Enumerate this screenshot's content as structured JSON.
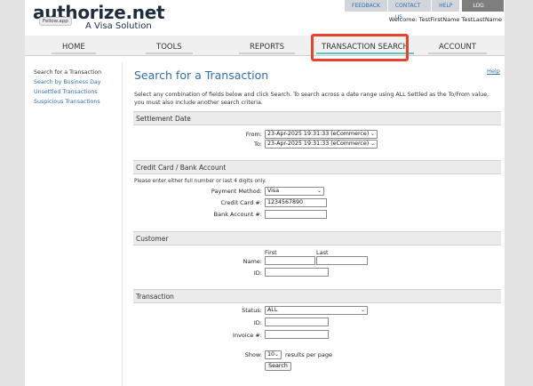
{
  "header": {
    "logo": "authorize.net",
    "tagline": "A Visa Solution",
    "badge": "Fellow.app",
    "welcome": "Welcome: TestFirstName TestLastName",
    "links": [
      "FEEDBACK",
      "CONTACT US",
      "HELP"
    ],
    "logout": "LOG OUT"
  },
  "nav": {
    "tabs": [
      "HOME",
      "TOOLS",
      "REPORTS",
      "TRANSACTION SEARCH",
      "ACCOUNT"
    ],
    "active": "TRANSACTION SEARCH"
  },
  "sidebar": {
    "items": [
      "Search for a Transaction",
      "Search by Business Day",
      "Unsettled Transactions",
      "Suspicious Transactions"
    ]
  },
  "main": {
    "title": "Search for a Transaction",
    "help": "Help",
    "intro": "Select any combination of fields below and click Search. To search across a date range using ALL Settled as the To/From value, you must also include another search criteria."
  },
  "settlement": {
    "heading": "Settlement Date",
    "from_label": "From:",
    "from_value": "23-Apr-2025 19:31:33 (eCommerce)",
    "to_label": "To:",
    "to_value": "23-Apr-2025 19:31:33 (eCommerce)"
  },
  "card": {
    "heading": "Credit Card / Bank Account",
    "note": "Please enter either full number or last 4 digits only.",
    "payment_label": "Payment Method:",
    "payment_value": "Visa",
    "cc_label": "Credit Card #:",
    "cc_value": "1234567890",
    "bank_label": "Bank Account #:",
    "bank_value": ""
  },
  "customer": {
    "heading": "Customer",
    "first_label": "First",
    "last_label": "Last",
    "name_label": "Name:",
    "id_label": "ID:"
  },
  "transaction": {
    "heading": "Transaction",
    "status_label": "Status:",
    "status_value": "ALL",
    "id_label": "ID:",
    "invoice_label": "Invoice #:",
    "show_label": "Show:",
    "show_value": "10",
    "per_page": "results per page",
    "search_button": "Search"
  }
}
